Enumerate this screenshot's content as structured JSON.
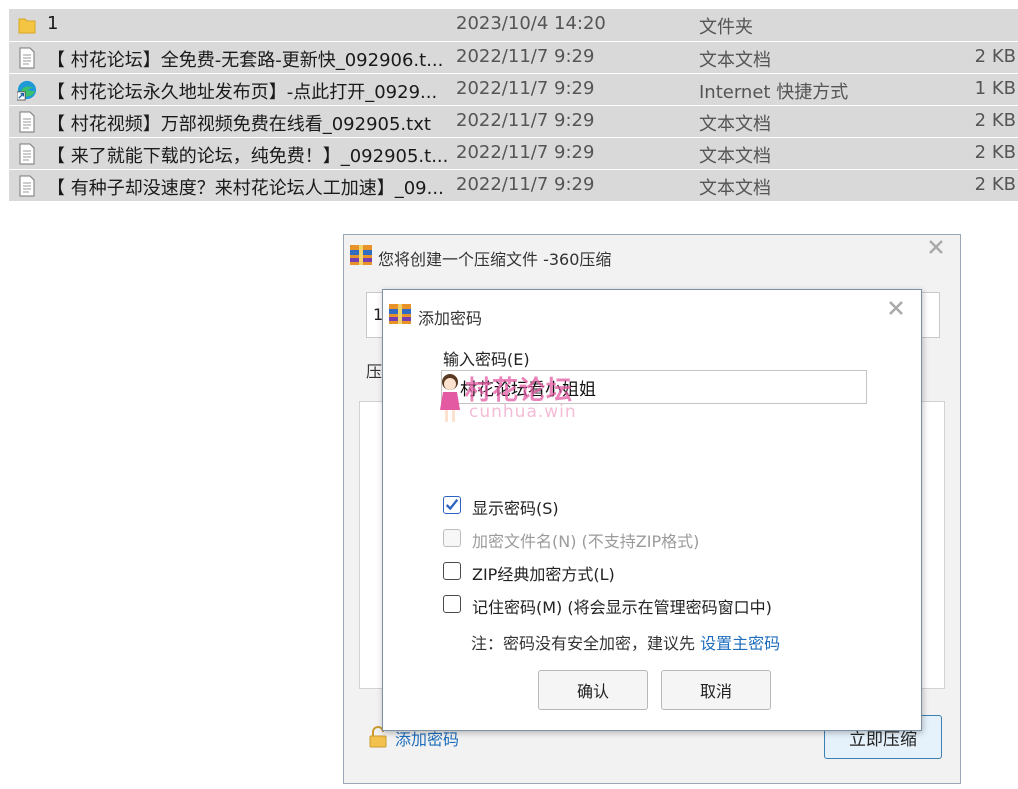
{
  "files": [
    {
      "icon": "folder-icon",
      "name": "1",
      "date": "2023/10/4 14:20",
      "type": "文件夹",
      "size": ""
    },
    {
      "icon": "text-file-icon",
      "name": "【 村花论坛】全免费-无套路-更新快_092906.t...",
      "date": "2022/11/7 9:29",
      "type": "文本文档",
      "size": "2 KB"
    },
    {
      "icon": "internet-shortcut-icon",
      "name": "【 村花论坛永久地址发布页】-点此打开_0929...",
      "date": "2022/11/7 9:29",
      "type": "Internet 快捷方式",
      "size": "1 KB"
    },
    {
      "icon": "text-file-icon",
      "name": "【 村花视频】万部视频免费在线看_092905.txt",
      "date": "2022/11/7 9:29",
      "type": "文本文档",
      "size": "2 KB"
    },
    {
      "icon": "text-file-icon",
      "name": "【 来了就能下载的论坛，纯免费！】_092905.t...",
      "date": "2022/11/7 9:29",
      "type": "文本文档",
      "size": "2 KB"
    },
    {
      "icon": "text-file-icon",
      "name": "【 有种子却没速度？来村花论坛人工加速】_09...",
      "date": "2022/11/7 9:29",
      "type": "文本文档",
      "size": "2 KB"
    }
  ],
  "outer_dialog": {
    "title": "您将创建一个压缩文件 -360压缩",
    "filename_value": "1",
    "label": "压",
    "add_password": "添加密码",
    "compress_button": "立即压缩"
  },
  "password_dialog": {
    "title": "添加密码",
    "input_label": "输入密码(E)",
    "password_value": "村花论坛看小姐姐",
    "options": [
      {
        "label": "显示密码(S)",
        "checked": true,
        "disabled": false
      },
      {
        "label": "加密文件名(N) (不支持ZIP格式)",
        "checked": false,
        "disabled": true
      },
      {
        "label": "ZIP经典加密方式(L)",
        "checked": false,
        "disabled": false
      },
      {
        "label": "记住密码(M) (将会显示在管理密码窗口中)",
        "checked": false,
        "disabled": false
      }
    ],
    "note_prefix": "注：密码没有安全加密，建议先 ",
    "note_link": "设置主密码",
    "ok_label": "确认",
    "cancel_label": "取消"
  },
  "watermark": {
    "text": "村花论坛",
    "subtext": "cunhua.win"
  },
  "colors": {
    "list_bg": "#d9d9d9",
    "link": "#1e6dbc",
    "checkbox_accent": "#2c63c0",
    "watermark": "#e35aa3"
  }
}
